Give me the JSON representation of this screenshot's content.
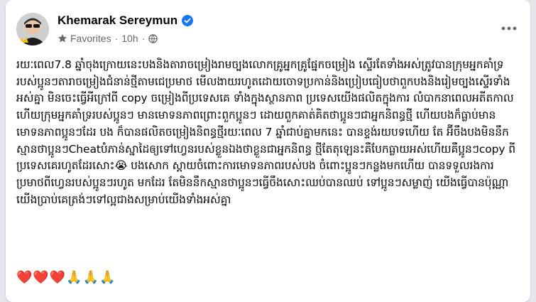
{
  "post": {
    "author": "Khemarak Sereymun",
    "audience": "Favorites",
    "time": "10h",
    "body": "រយៈពេល7.8 ឆ្នាំចុងក្រោយនេះបងនិងតារាចម្រៀងរាមច្បងលោកគ្រូអ្នកគ្រូផ្នែកចម្រៀង ស្ទើរតែទាំងអស់ត្រូវបានក្រុមអ្នកគាំទ្ររបស់ប្អូនៗតារាចម្រៀងជំនាន់ថ្មីតាមជេប្រមាថ មើលងាយរហូតដោយចោទប្រកាន់និងប្រៀបធៀបថាពួកបងនិងរៀមច្បងស្ទើរទាំងអស់គ្នា មិនចេះធ្វើអីក្រៅពី copy ចម្រៀងពីប្រទេសគេ ទាំងក្នុងស្ថានភាព ប្រទេសយើងផលិតក្នុងការ លំបាកនាពេលអតីតកាលហើយក្រុមអ្នកគាំទ្ររបស់ប្អូនៗ មានមោទនភាពព្រោះពួកប្អូនៗ ដោយពួកគាត់គិតថាប្អូនៗជាអ្នកនិពន្ធថ្មី ហើយបងក៏ធ្លាប់មានមោទនភាពប្អូនៗដែរ បង ក៏បានផលិតចម្រៀងនិពន្ធថ្មីរយៈពេល 7 ឆ្នាំជាប់គ្នាមកនេះ បានខ្ទង់រយបទហើយ តែ អ៊ីចឹងបងមិននឹកស្មានថាប្អូនៗCheatបំភាន់ស្នាដៃឲ្យទៅហ្វេនរបស់ខ្លួនឯងថាខ្លួនជាអ្នកនិពន្ធ ថ្មីតែតុឡេនះគឺបែកធ្លាយអស់ហើយគឺប្អូនៗcopy ពីប្រទេសគេរហូតដែរសោះ😭 បងសោក ស្តាយចំពោះការមោទនភាពរបស់បង ចំពោះប្អូនៗកន្លងមកហើយ បានទទួលរងការ ប្រមាថពីហ្វេនរបស់ប្អូនៗរហូត មកដែរ តែមិននឹកស្មានថាប្អូនៗធ្វើចឹងសោះឈប់បានឈប់ ទៅប្អូនៗសម្លាញ់ យើងធ្វើបានប៉ុណ្ណាយើងប្រាប់គេត្រង់ៗទៅល្អជាងសម្រាប់យើងទាំងអស់គ្នា",
    "reactions": "❤️❤️❤️🙏🙏🙏"
  },
  "colors": {
    "text": "#050505",
    "secondary": "#65676b",
    "verified": "#1877f2",
    "background": "#e4e6eb",
    "card": "#ffffff"
  },
  "icons": {
    "verified": "verified-badge-icon",
    "audience": "favorites-star-icon",
    "privacy": "globe-icon",
    "more": "more-options-icon"
  }
}
